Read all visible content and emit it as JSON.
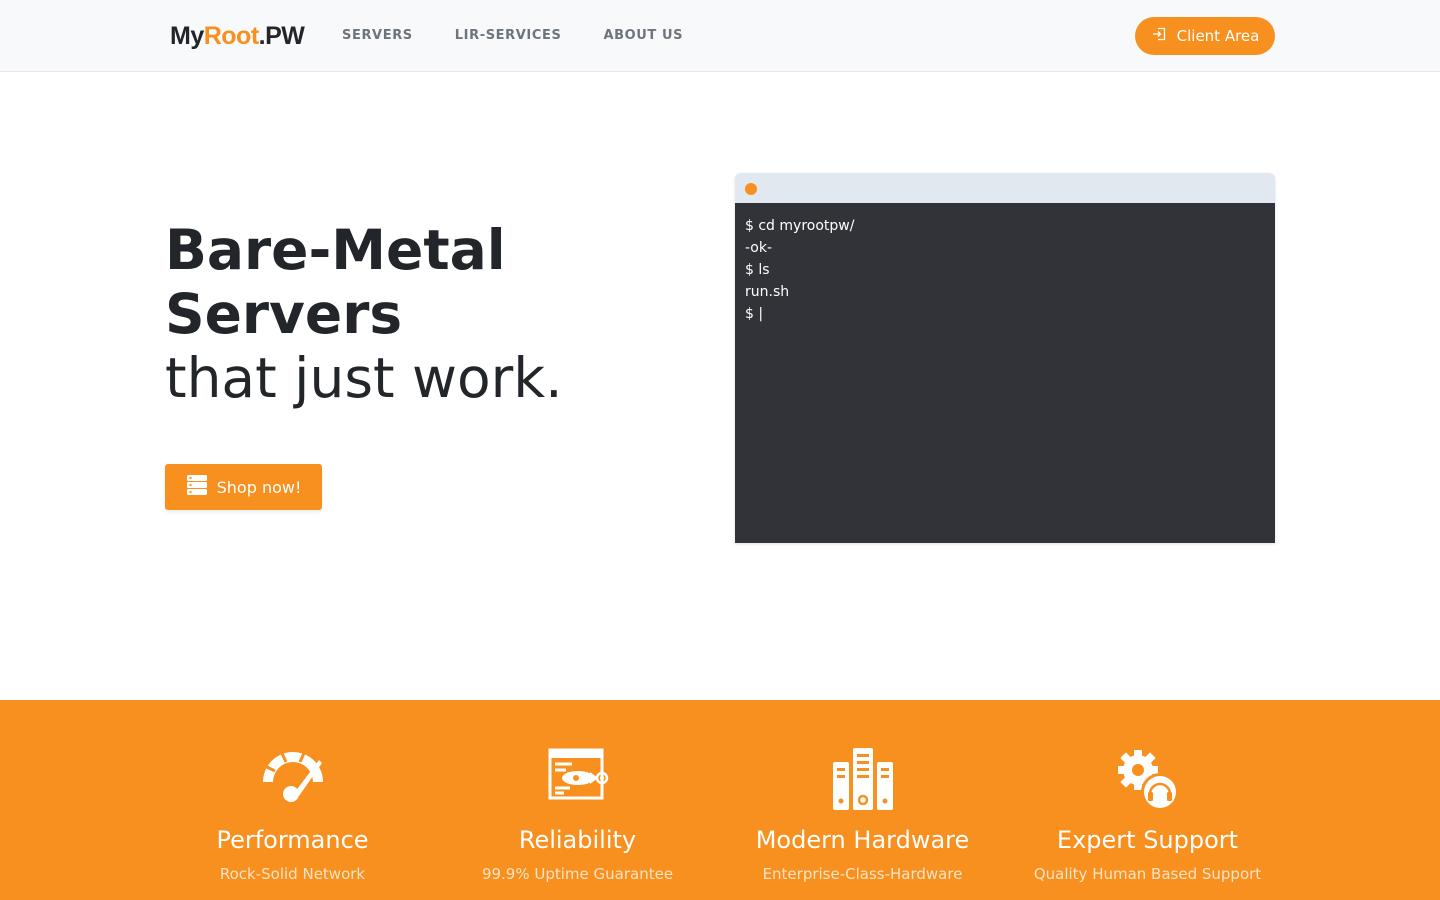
{
  "header": {
    "logo": {
      "part1": "My",
      "part2": "Root",
      "part3": ".PW"
    },
    "nav": [
      {
        "label": "SERVERS"
      },
      {
        "label": "LIR-SERVICES"
      },
      {
        "label": "ABOUT US"
      }
    ],
    "client_area_label": "Client Area"
  },
  "hero": {
    "title_line1": "Bare-Metal",
    "title_line2": "Servers",
    "title_line3": "that just work.",
    "shop_label": "Shop now!"
  },
  "terminal": {
    "lines": [
      "$ cd myrootpw/",
      "-ok-",
      "$ ls",
      "run.sh",
      "$ |"
    ]
  },
  "features": [
    {
      "icon": "speedometer-icon",
      "title": "Performance",
      "subtitle": "Rock-Solid Network"
    },
    {
      "icon": "rocket-window-icon",
      "title": "Reliability",
      "subtitle": "99.9% Uptime Guarantee"
    },
    {
      "icon": "server-tower-icon",
      "title": "Modern Hardware",
      "subtitle": "Enterprise-Class-Hardware"
    },
    {
      "icon": "gear-headset-icon",
      "title": "Expert Support",
      "subtitle": "Quality Human Based Support"
    }
  ],
  "colors": {
    "accent": "#f7901e",
    "header_bg": "#f8f9fa",
    "terminal_bg": "#313338",
    "terminal_bar": "#e2e8f0",
    "text_dark": "#222529"
  }
}
